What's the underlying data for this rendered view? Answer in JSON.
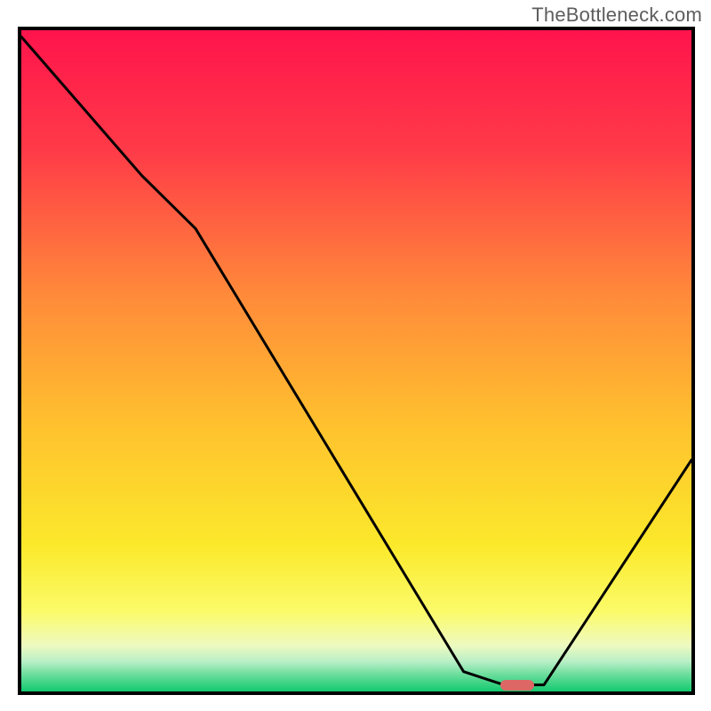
{
  "watermark": "TheBottleneck.com",
  "chart_data": {
    "type": "line",
    "title": "",
    "xlabel": "",
    "ylabel": "",
    "xlim": [
      0,
      100
    ],
    "ylim": [
      0,
      100
    ],
    "grid": false,
    "series": [
      {
        "name": "bottleneck-curve",
        "x": [
          0,
          18,
          26,
          66,
          72,
          78,
          100
        ],
        "y": [
          99,
          78,
          70,
          3,
          1,
          1,
          35
        ],
        "color": "#000000"
      }
    ],
    "marker": {
      "name": "optimal-marker",
      "x": 74,
      "y": 1,
      "color": "#dd6765"
    },
    "background_gradient": {
      "stops": [
        {
          "offset": 0,
          "color": "#ff144c"
        },
        {
          "offset": 0.18,
          "color": "#ff3a48"
        },
        {
          "offset": 0.4,
          "color": "#ff8a3a"
        },
        {
          "offset": 0.6,
          "color": "#ffc22e"
        },
        {
          "offset": 0.78,
          "color": "#fbe92b"
        },
        {
          "offset": 0.88,
          "color": "#fbfb6a"
        },
        {
          "offset": 0.93,
          "color": "#eefac0"
        },
        {
          "offset": 0.955,
          "color": "#b8efc6"
        },
        {
          "offset": 0.975,
          "color": "#69dd9b"
        },
        {
          "offset": 1.0,
          "color": "#13c96f"
        }
      ]
    }
  }
}
